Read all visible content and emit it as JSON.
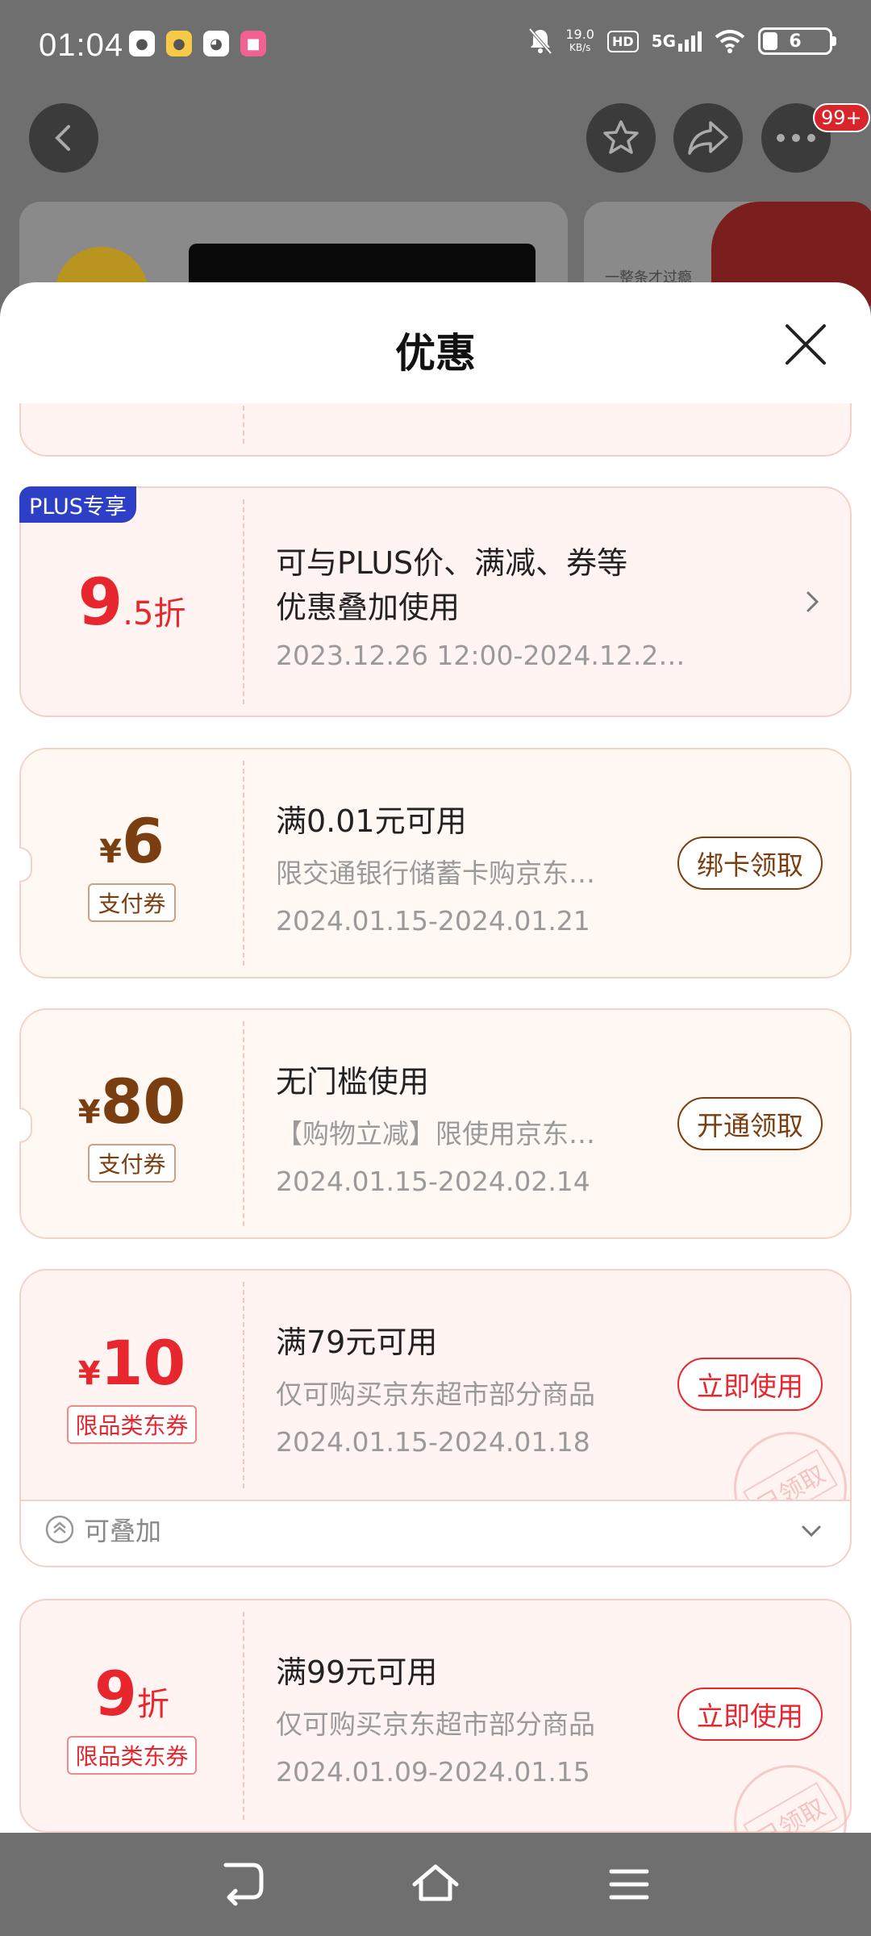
{
  "status_bar": {
    "time": "01:04",
    "net_speed_value": "19.0",
    "net_speed_unit": "KB/s",
    "hd_label": "HD",
    "network": "5G",
    "battery": "6"
  },
  "header": {
    "badge": "99+",
    "bg_card_text": "一整条才过瘾"
  },
  "sheet": {
    "title": "优惠"
  },
  "coupons": [
    {
      "badge": "PLUS专享",
      "value_main": "9",
      "value_suffix": ".5折",
      "title_line1": "可与PLUS价、满减、券等",
      "title_line2": "优惠叠加使用",
      "date": "2023.12.26 12:00-2024.12.2…"
    },
    {
      "currency": "¥",
      "value_main": "6",
      "tag": "支付券",
      "title": "满0.01元可用",
      "sub": "限交通银行储蓄卡购京东…",
      "date": "2024.01.15-2024.01.21",
      "action": "绑卡领取"
    },
    {
      "currency": "¥",
      "value_main": "80",
      "tag": "支付券",
      "title": "无门槛使用",
      "sub": "【购物立减】限使用京东…",
      "date": "2024.01.15-2024.02.14",
      "action": "开通领取"
    },
    {
      "currency": "¥",
      "value_main": "10",
      "tag": "限品类东券",
      "title": "满79元可用",
      "sub": "仅可购买京东超市部分商品",
      "date": "2024.01.15-2024.01.18",
      "action": "立即使用",
      "stamp": "已领取",
      "stackable": "可叠加"
    },
    {
      "value_main": "9",
      "value_suffix": "折",
      "tag": "限品类东券",
      "title": "满99元可用",
      "sub": "仅可购买京东超市部分商品",
      "date": "2024.01.09-2024.01.15",
      "action": "立即使用",
      "stamp": "已领取"
    }
  ],
  "colors": {
    "red": "#e8262e",
    "brown": "#7a3e10",
    "plus_blue": "#2d3fc6",
    "card_red_bg": "#fff4f2",
    "card_orange_bg": "#fff8f3"
  }
}
